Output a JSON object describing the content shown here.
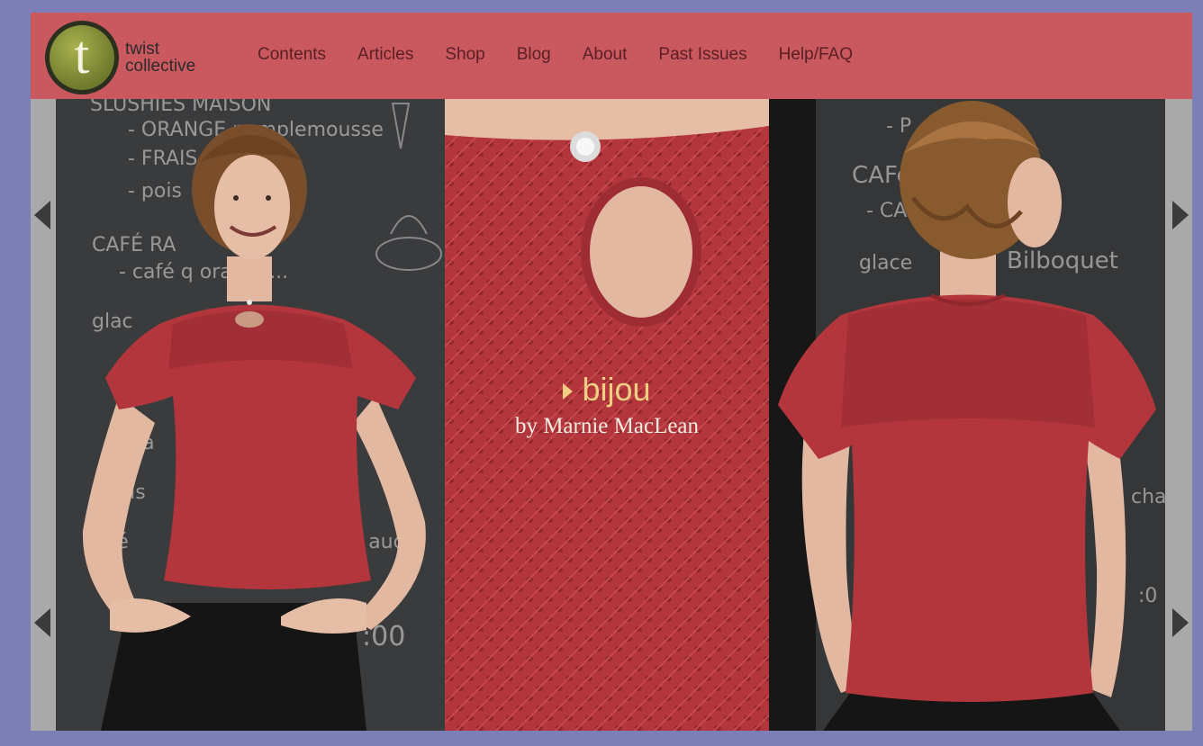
{
  "site": {
    "logo_letter": "t",
    "logo_line1": "twist",
    "logo_line2": "collective"
  },
  "nav": {
    "items": [
      "Contents",
      "Articles",
      "Shop",
      "Blog",
      "About",
      "Past Issues",
      "Help/FAQ"
    ]
  },
  "feature": {
    "title": "bijou",
    "byline": "by Marnie MacLean"
  },
  "chalkboard_left": [
    "SLUSHIES MAISON",
    "- ORANGE pamplemousse",
    "- FRAIS",
    "- pois",
    "CAFÉ RA",
    "- café q   orange...",
    "glac",
    "rea",
    "atis",
    "afé",
    "cl aud",
    ":00"
  ],
  "chalkboard_right": [
    "- P",
    "CAFé",
    "- CA         ange...",
    "glace",
    "Bilboquet",
    "cha",
    ":0"
  ],
  "colors": {
    "header_bg": "#c9585f",
    "page_border": "#7b7fb6",
    "sweater_red": "#b2363c",
    "caption_gold": "#f0cf83"
  }
}
